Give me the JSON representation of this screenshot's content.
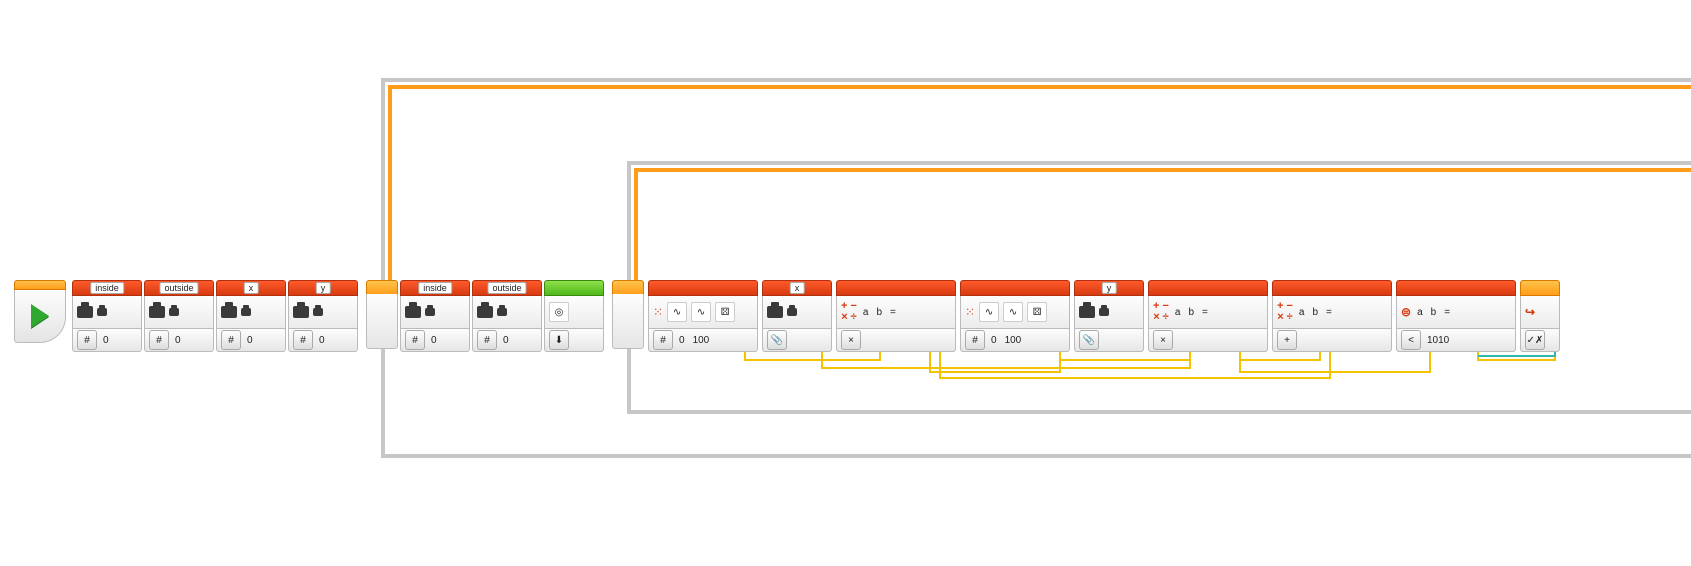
{
  "vars": [
    {
      "name": "inside",
      "value": "0"
    },
    {
      "name": "outside",
      "value": "0"
    },
    {
      "name": "x",
      "value": "0"
    },
    {
      "name": "y",
      "value": "0"
    },
    {
      "name": "inside",
      "value": "0"
    },
    {
      "name": "outside",
      "value": "0"
    }
  ],
  "random1": {
    "lower": "0",
    "upper": "100"
  },
  "random2": {
    "lower": "0",
    "upper": "100"
  },
  "read1": {
    "name": "x"
  },
  "read2": {
    "name": "y"
  },
  "math": {
    "labels": {
      "a": "a",
      "b": "b",
      "eq": "="
    },
    "ops": [
      "×",
      "×",
      "+"
    ]
  },
  "compare": {
    "op": "<",
    "value": "1010"
  }
}
